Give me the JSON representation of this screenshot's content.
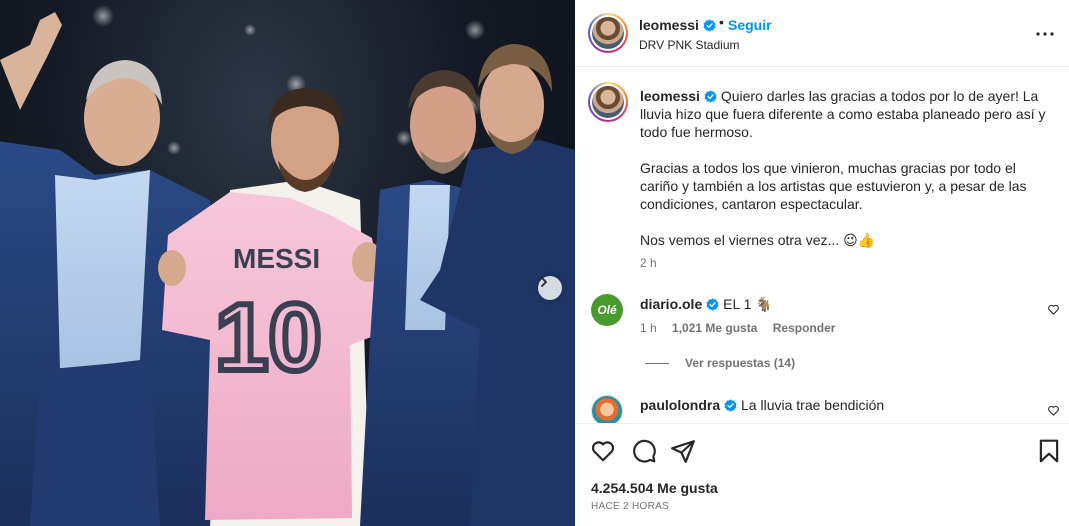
{
  "post": {
    "username": "leomessi",
    "follow_label": "Seguir",
    "location": "DRV PNK Stadium",
    "caption_paragraphs": [
      "Quiero darles las gracias a todos por lo de ayer! La lluvia hizo que fuera diferente a como estaba planeado pero así y todo fue hermoso.",
      "Gracias a todos los que vinieron, muchas gracias por todo el cariño y también a los artistas que estuvieron y, a pesar de las condiciones, cantaron espectacular.",
      "Nos vemos el viernes otra vez... 😉👍"
    ],
    "caption_time": "2 h",
    "likes": "4.254.504 Me gusta",
    "time_ago": "HACE 2 HORAS",
    "jersey_name": "MESSI",
    "jersey_number": "10"
  },
  "comments": [
    {
      "username": "diario.ole",
      "avatar_text": "Olé",
      "text": "EL 1 🐐",
      "time": "1 h",
      "likes": "1,021 Me gusta",
      "reply_label": "Responder",
      "view_replies": "Ver respuestas (14)"
    },
    {
      "username": "paulolondra",
      "text": "La lluvia trae bendición"
    }
  ],
  "colors": {
    "verified": "#0095f6",
    "follow": "#0095f6",
    "jersey": "#f3b9cf",
    "ole": "#4a9b2d"
  },
  "icons": [
    "verified-icon",
    "more-options-icon",
    "heart-icon",
    "comment-icon",
    "share-icon",
    "save-icon",
    "chevron-right-icon"
  ]
}
